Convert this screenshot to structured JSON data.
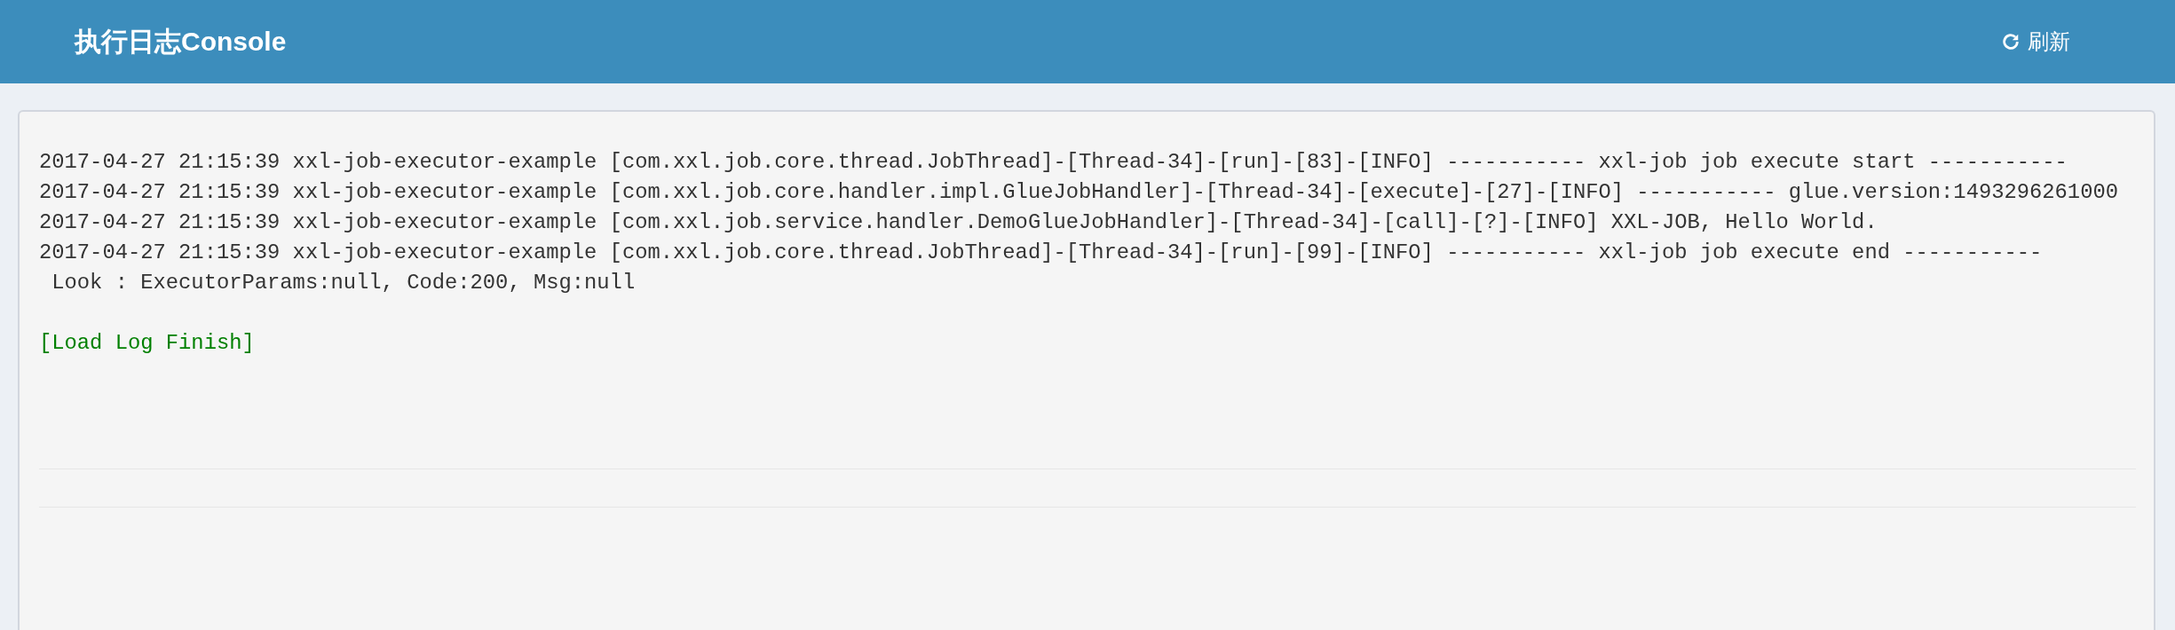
{
  "header": {
    "title": "执行日志Console",
    "refresh_button": "刷新"
  },
  "log_lines": [
    "2017-04-27 21:15:39 xxl-job-executor-example [com.xxl.job.core.thread.JobThread]-[Thread-34]-[run]-[83]-[INFO] ----------- xxl-job job execute start -----------",
    "2017-04-27 21:15:39 xxl-job-executor-example [com.xxl.job.core.handler.impl.GlueJobHandler]-[Thread-34]-[execute]-[27]-[INFO] ----------- glue.version:1493296261000",
    "2017-04-27 21:15:39 xxl-job-executor-example [com.xxl.job.service.handler.DemoGlueJobHandler]-[Thread-34]-[call]-[?]-[INFO] XXL-JOB, Hello World.",
    "2017-04-27 21:15:39 xxl-job-executor-example [com.xxl.job.core.thread.JobThread]-[Thread-34]-[run]-[99]-[INFO] ----------- xxl-job job execute end -----------",
    " Look : ExecutorParams:null, Code:200, Msg:null"
  ],
  "status_line": "[Load Log Finish]"
}
